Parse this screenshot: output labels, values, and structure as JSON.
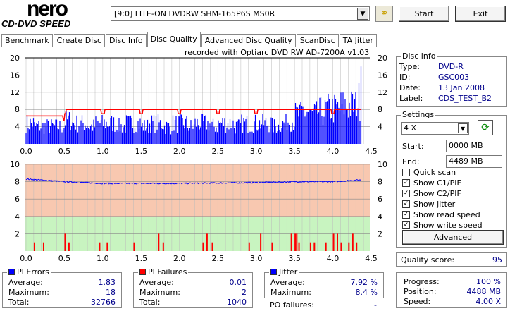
{
  "app": {
    "logo_top": "nero",
    "logo_bottom": "CD·DVD SPEED"
  },
  "toolbar": {
    "drive": "[9:0]  LITE-ON DVDRW SHM-165P6S MS0R",
    "start": "Start",
    "exit": "Exit",
    "refresh_icon": "chain-icon"
  },
  "tabs": [
    "Benchmark",
    "Create Disc",
    "Disc Info",
    "Disc Quality",
    "Advanced Disc Quality",
    "ScanDisc",
    "TA Jitter"
  ],
  "active_tab": "Disc Quality",
  "recorded_with": "recorded with Optiarc DVD RW AD-7200A  v1.03",
  "disc_info": {
    "title": "Disc info",
    "type_label": "Type:",
    "type": "DVD-R",
    "id_label": "ID:",
    "id": "GSC003",
    "date_label": "Date:",
    "date": "13 Jan 2008",
    "label_label": "Label:",
    "label": "CDS_TEST_B2"
  },
  "settings": {
    "title": "Settings",
    "speed": "4 X",
    "start_label": "Start:",
    "start": "0000 MB",
    "end_label": "End:",
    "end": "4489 MB",
    "checks": [
      {
        "label": "Quick scan",
        "checked": false
      },
      {
        "label": "Show C1/PIE",
        "checked": true
      },
      {
        "label": "Show C2/PIF",
        "checked": true
      },
      {
        "label": "Show jitter",
        "checked": true
      },
      {
        "label": "Show read speed",
        "checked": true
      },
      {
        "label": "Show write speed",
        "checked": true
      }
    ],
    "advanced": "Advanced"
  },
  "quality": {
    "label": "Quality score:",
    "value": "95"
  },
  "pi_errors": {
    "title": "PI Errors",
    "color": "#0000ff",
    "average_label": "Average:",
    "average": "1.83",
    "maximum_label": "Maximum:",
    "maximum": "18",
    "total_label": "Total:",
    "total": "32766"
  },
  "pi_failures": {
    "title": "PI Failures",
    "color": "#ff0000",
    "average_label": "Average:",
    "average": "0.01",
    "maximum_label": "Maximum:",
    "maximum": "2",
    "total_label": "Total:",
    "total": "1040"
  },
  "jitter": {
    "title": "Jitter",
    "color": "#0000ff",
    "average_label": "Average:",
    "average": "7.92 %",
    "maximum_label": "Maximum:",
    "maximum": "8.4 %",
    "po_label": "PO failures:",
    "po": "-"
  },
  "progress": {
    "progress_label": "Progress:",
    "progress": "100 %",
    "position_label": "Position:",
    "position": "4488 MB",
    "speed_label": "Speed:",
    "speed": "4.00 X"
  },
  "chart_data": [
    {
      "type": "bar",
      "title": "PI Errors / read speed",
      "xlim": [
        0,
        4.5
      ],
      "ylim": [
        0,
        20
      ],
      "yticks": [
        4,
        8,
        12,
        16,
        20
      ],
      "xticks": [
        "0.0",
        "0.5",
        "1.0",
        "1.5",
        "2.0",
        "2.5",
        "3.0",
        "3.5",
        "4.0",
        "4.5"
      ],
      "pi_errors_max_per_0_1GB": [
        7,
        6,
        6,
        6,
        6,
        8,
        7,
        7,
        6,
        7,
        7,
        7,
        6,
        7,
        7,
        6,
        7,
        7,
        6,
        7,
        7,
        6,
        7,
        7,
        6,
        7,
        7,
        6,
        7,
        7,
        7,
        7,
        6,
        7,
        8,
        10,
        11,
        10,
        11,
        12,
        12,
        13,
        13,
        15
      ],
      "pi_errors_end": 18,
      "read_speed": {
        "x": [
          0,
          0.5,
          0.52,
          4.37
        ],
        "y": [
          6.5,
          6.5,
          8,
          8
        ],
        "dips_at": [
          0.5,
          1.0,
          1.5,
          2.0,
          2.5,
          3.0,
          4.0
        ]
      }
    },
    {
      "type": "bar",
      "title": "PI Failures / jitter",
      "xlim": [
        0,
        4.5
      ],
      "ylim": [
        0,
        10
      ],
      "yticks": [
        2,
        4,
        6,
        8,
        10
      ],
      "xticks": [
        "0.0",
        "0.5",
        "1.0",
        "1.5",
        "2.0",
        "2.5",
        "3.0",
        "3.5",
        "4.0",
        "4.5"
      ],
      "jitter": {
        "x": [
          0,
          0.5,
          1.0,
          2.0,
          3.0,
          3.5,
          4.0,
          4.37
        ],
        "y": [
          8.3,
          8.0,
          7.8,
          7.8,
          7.9,
          8.0,
          8.0,
          8.2
        ]
      },
      "pi_failures": {
        "x": [
          0.1,
          0.22,
          0.5,
          0.55,
          0.95,
          1.05,
          1.4,
          1.72,
          1.78,
          2.3,
          2.35,
          2.42,
          2.9,
          3.05,
          3.2,
          3.45,
          3.5,
          3.52,
          3.55,
          3.7,
          3.75,
          3.9,
          4.0,
          4.05,
          4.1,
          4.2,
          4.25,
          4.3
        ],
        "y": [
          1,
          1,
          2,
          1,
          1,
          1,
          1,
          2,
          1,
          1,
          2,
          1,
          1,
          2,
          1,
          2,
          2,
          2,
          1,
          1,
          1,
          1,
          2,
          2,
          1,
          1,
          2,
          1
        ]
      }
    }
  ]
}
